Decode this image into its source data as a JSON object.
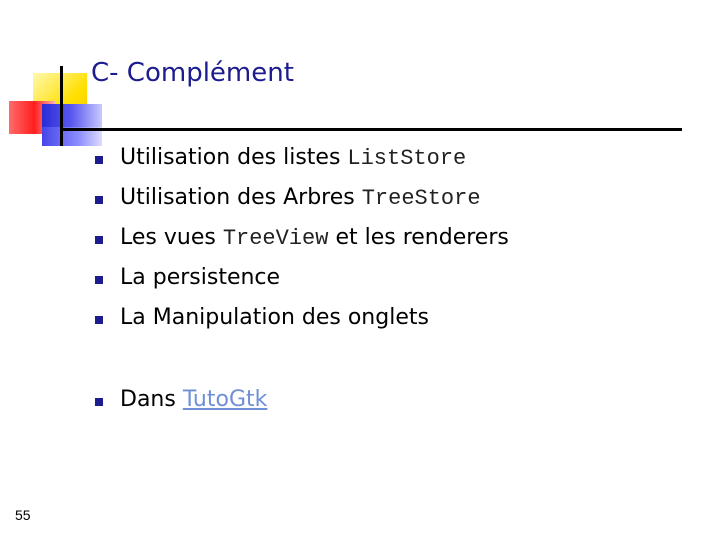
{
  "slide": {
    "title": "C- Complément",
    "page_number": "55",
    "items": [
      {
        "text": "Utilisation des listes ",
        "code": "ListStore",
        "after": ""
      },
      {
        "text": "Utilisation des Arbres ",
        "code": "TreeStore",
        "after": ""
      },
      {
        "text": "Les vues ",
        "code": "TreeView",
        "after": " et les renderers"
      },
      {
        "text": "La persistence",
        "code": "",
        "after": ""
      },
      {
        "text": "La Manipulation des onglets",
        "code": "",
        "after": ""
      }
    ],
    "link_item": {
      "text": "Dans ",
      "link": "TutoGtk"
    },
    "colors": {
      "title": "#1c1c8e",
      "bullet": "#1c1c8e",
      "link": "#6f8fd8"
    }
  }
}
